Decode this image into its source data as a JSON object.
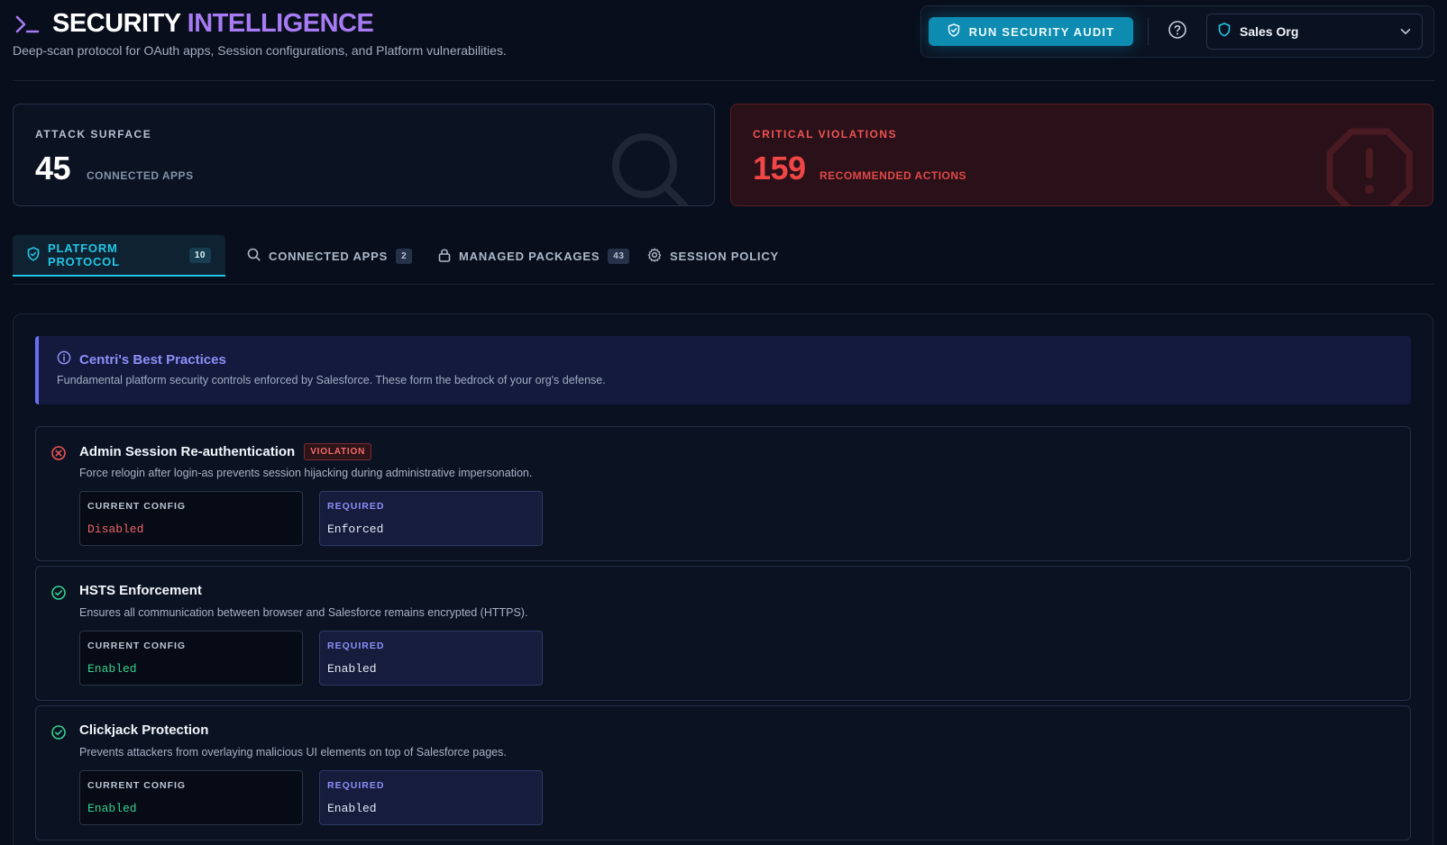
{
  "header": {
    "title_part1": "SECURITY",
    "title_part2": "INTELLIGENCE",
    "subtitle": "Deep-scan protocol for OAuth apps, Session configurations, and Platform vulnerabilities.",
    "audit_button": "RUN SECURITY AUDIT",
    "org_selector": "Sales Org"
  },
  "stats": {
    "attack_surface": {
      "label": "ATTACK SURFACE",
      "value": "45",
      "unit": "CONNECTED APPS"
    },
    "critical_violations": {
      "label": "CRITICAL VIOLATIONS",
      "value": "159",
      "unit": "RECOMMENDED ACTIONS"
    }
  },
  "tabs": [
    {
      "label": "PLATFORM PROTOCOL",
      "count": "10",
      "icon": "shield-icon",
      "active": true
    },
    {
      "label": "CONNECTED APPS",
      "count": "2",
      "icon": "search-icon",
      "active": false
    },
    {
      "label": "MANAGED PACKAGES",
      "count": "43",
      "icon": "lock-icon",
      "active": false
    },
    {
      "label": "SESSION POLICY",
      "count": "",
      "icon": "gear-icon",
      "active": false
    }
  ],
  "info": {
    "title": "Centri's Best Practices",
    "text": "Fundamental platform security controls enforced by Salesforce. These form the bedrock of your org's defense."
  },
  "rules": [
    {
      "title": "Admin Session Re-authentication",
      "tag": "VIOLATION",
      "status": "violation",
      "description": "Force relogin after login-as prevents session hijacking during administrative impersonation.",
      "current_label": "CURRENT CONFIG",
      "current_value": "Disabled",
      "required_label": "REQUIRED",
      "required_value": "Enforced"
    },
    {
      "title": "HSTS Enforcement",
      "tag": "",
      "status": "pass",
      "description": "Ensures all communication between browser and Salesforce remains encrypted (HTTPS).",
      "current_label": "CURRENT CONFIG",
      "current_value": "Enabled",
      "required_label": "REQUIRED",
      "required_value": "Enabled"
    },
    {
      "title": "Clickjack Protection",
      "tag": "",
      "status": "pass",
      "description": "Prevents attackers from overlaying malicious UI elements on top of Salesforce pages.",
      "current_label": "CURRENT CONFIG",
      "current_value": "Enabled",
      "required_label": "REQUIRED",
      "required_value": "Enabled"
    }
  ],
  "colors": {
    "background": "#080e1b",
    "accent_cyan": "#22c7e6",
    "accent_purple": "#a67bf3",
    "danger": "#f04646",
    "success": "#34d28f"
  }
}
